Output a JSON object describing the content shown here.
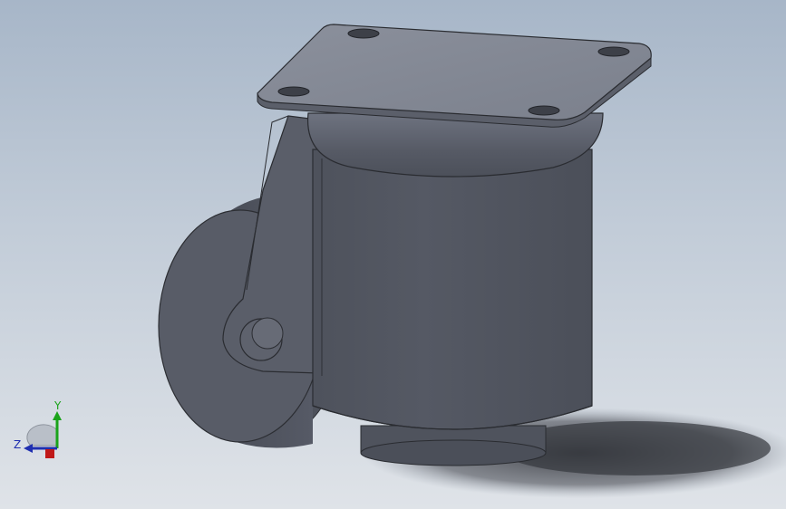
{
  "view": {
    "background_top": "#a7b6c8",
    "background_bottom": "#dfe3e8",
    "model_color": "#545863"
  },
  "triad": {
    "x_label": "",
    "y_label": "Y",
    "z_label": "Z",
    "y_color": "#1aa31a",
    "z_color": "#1f2fb0",
    "x_color": "#c01818"
  }
}
